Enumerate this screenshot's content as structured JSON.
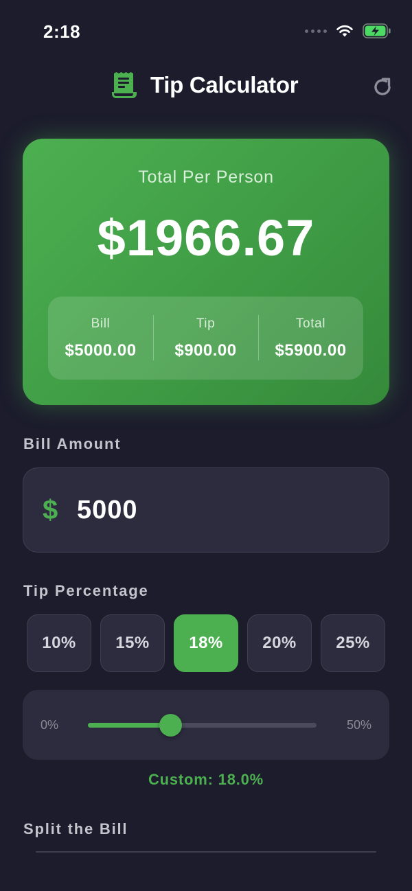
{
  "status_bar": {
    "time": "2:18",
    "icons": [
      "signal-dots-icon",
      "wifi-icon",
      "battery-charging-icon"
    ]
  },
  "header": {
    "icon": "receipt-icon",
    "title": "Tip Calculator",
    "reset_icon": "refresh-icon"
  },
  "summary": {
    "per_person_label": "Total Per Person",
    "per_person_value": "$1966.67",
    "breakdown": [
      {
        "label": "Bill",
        "value": "$5000.00"
      },
      {
        "label": "Tip",
        "value": "$900.00"
      },
      {
        "label": "Total",
        "value": "$5900.00"
      }
    ]
  },
  "bill": {
    "label": "Bill Amount",
    "currency_symbol": "$",
    "value": "5000"
  },
  "tip": {
    "label": "Tip Percentage",
    "options": [
      "10%",
      "15%",
      "18%",
      "20%",
      "25%"
    ],
    "selected": "18%",
    "slider_min_label": "0%",
    "slider_max_label": "50%",
    "slider_value_percent": 18,
    "slider_max_percent": 50,
    "custom_readout": "Custom: 18.0%"
  },
  "split": {
    "label": "Split the Bill"
  },
  "colors": {
    "background": "#1c1c2c",
    "accent": "#4caf50",
    "surface": "#2c2c3e"
  }
}
